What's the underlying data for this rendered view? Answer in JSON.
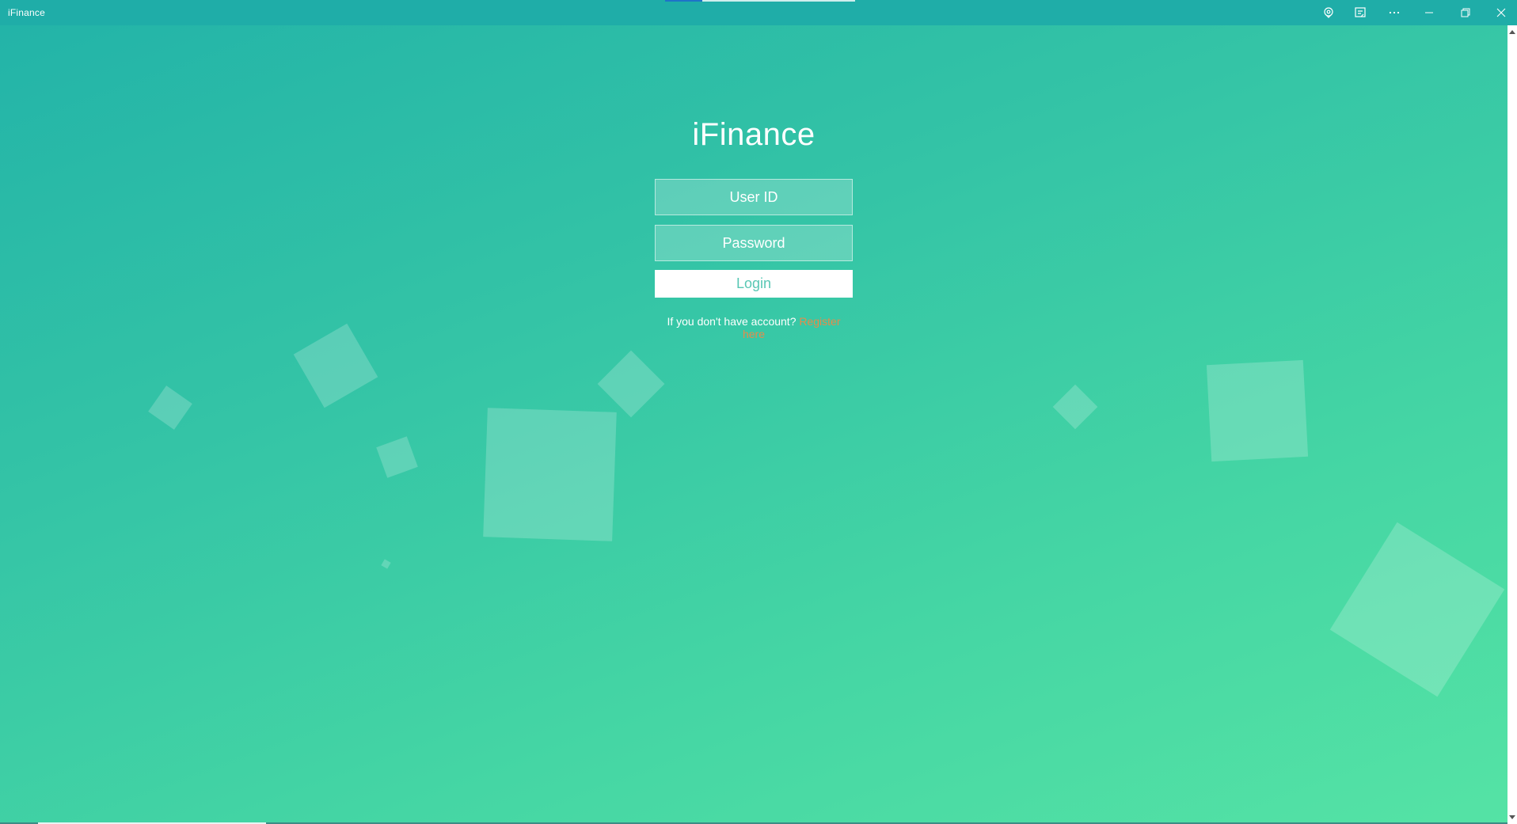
{
  "window": {
    "title": "iFinance",
    "controls": {
      "location_icon": "location-pin-icon",
      "cast_icon": "cast-icon",
      "more_icon": "ellipsis-icon",
      "minimize_icon": "minimize-icon",
      "restore_icon": "restore-icon",
      "close_icon": "close-icon"
    }
  },
  "login": {
    "app_name": "iFinance",
    "user_id_placeholder": "User ID",
    "password_placeholder": "Password",
    "login_label": "Login",
    "register_prompt": "If you don't have account?",
    "register_link": "Register here"
  },
  "colors": {
    "background_start": "#22b3a8",
    "background_end": "#55e3a5",
    "titlebar": "#1fada8",
    "login_button_text": "#59c7b4",
    "register_link": "#e88b4a"
  }
}
